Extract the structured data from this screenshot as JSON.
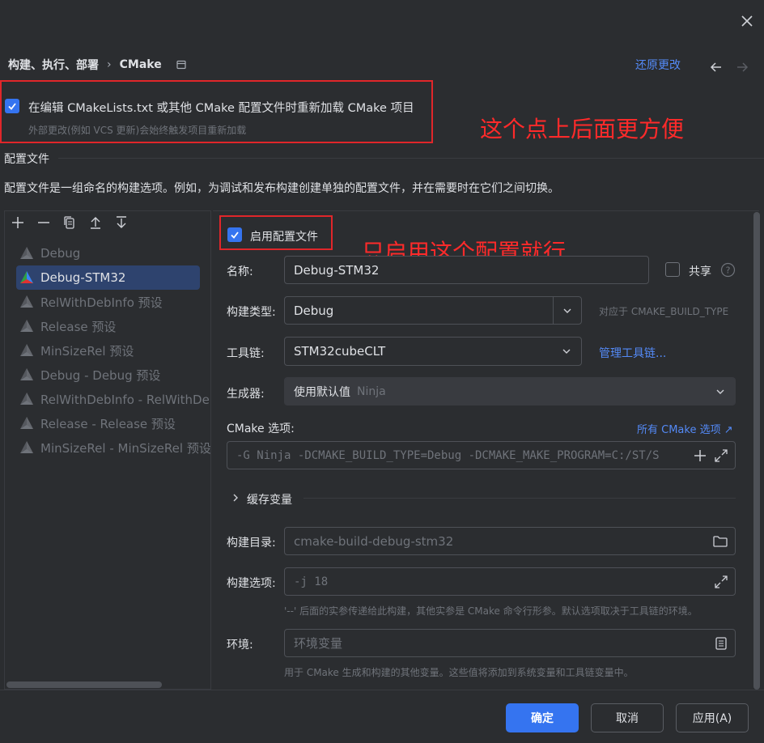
{
  "header": {
    "breadcrumb_parent": "构建、执行、部署",
    "breadcrumb_sep": "›",
    "breadcrumb_current": "CMake",
    "restore_label": "还原更改"
  },
  "reload_option": {
    "checked": true,
    "label": "在编辑 CMakeLists.txt 或其他 CMake 配置文件时重新加载 CMake 项目",
    "hint": "外部更改(例如 VCS 更新)会始终触发项目重新加载"
  },
  "annotations": {
    "top": "这个点上后面更方便",
    "middle": "只启用这个配置就行"
  },
  "profiles_section": {
    "title": "配置文件",
    "description": "配置文件是一组命名的构建选项。例如，为调试和发布构建创建单独的配置文件，并在需要时在它们之间切换。"
  },
  "profiles": [
    {
      "label": "Debug",
      "selected": false
    },
    {
      "label": "Debug-STM32",
      "selected": true
    },
    {
      "label": "RelWithDebInfo 预设",
      "selected": false
    },
    {
      "label": "Release 预设",
      "selected": false
    },
    {
      "label": "MinSizeRel 预设",
      "selected": false
    },
    {
      "label": "Debug - Debug 预设",
      "selected": false
    },
    {
      "label": "RelWithDebInfo - RelWithDebInfo 预设",
      "selected": false
    },
    {
      "label": "Release - Release 预设",
      "selected": false
    },
    {
      "label": "MinSizeRel - MinSizeRel 预设",
      "selected": false
    }
  ],
  "toolbar_icons": [
    "add-icon",
    "remove-icon",
    "copy-icon",
    "move-up-icon",
    "move-down-icon"
  ],
  "form": {
    "enable_label": "启用配置文件",
    "enable_checked": true,
    "name_label": "名称:",
    "name_value": "Debug-STM32",
    "share_label": "共享",
    "share_checked": false,
    "build_type_label": "构建类型:",
    "build_type_value": "Debug",
    "build_type_hint": "对应于 CMAKE_BUILD_TYPE",
    "toolchain_label": "工具链:",
    "toolchain_value": "STM32cubeCLT",
    "manage_toolchains": "管理工具链...",
    "generator_label": "生成器:",
    "generator_value": "使用默认值",
    "generator_hint": "Ninja",
    "cmake_options_label": "CMake 选项:",
    "all_cmake_options": "所有 CMake 选项 ↗",
    "cmake_options_value": "-G Ninja -DCMAKE_BUILD_TYPE=Debug -DCMAKE_MAKE_PROGRAM=C:/ST/S",
    "cache_vars_label": "缓存变量",
    "build_dir_label": "构建目录:",
    "build_dir_value": "cmake-build-debug-stm32",
    "build_options_label": "构建选项:",
    "build_options_value": "-j 18",
    "build_options_help": "'--' 后面的实参传递给此构建，其他实参是 CMake 命令行形参。默认选项取决于工具链的环境。",
    "env_label": "环境:",
    "env_placeholder": "环境变量",
    "env_help": "用于 CMake 生成和构建的其他变量。这些值将添加到系统变量和工具链变量中。"
  },
  "buttons": {
    "ok": "确定",
    "cancel": "取消",
    "apply": "应用(A)"
  },
  "colors": {
    "accent": "#3574f0",
    "link": "#548af7",
    "annotation": "#ff2a2a",
    "background": "#2b2d30"
  }
}
